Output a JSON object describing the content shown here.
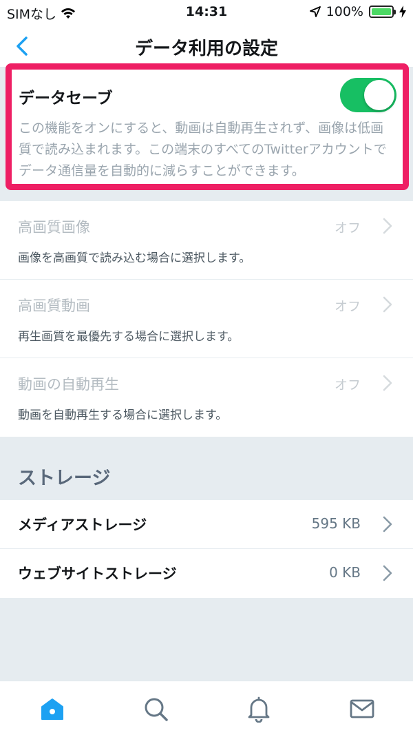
{
  "status_bar": {
    "carrier": "SIMなし",
    "time": "14:31",
    "battery": "100%",
    "wifi_icon": "wifi-icon",
    "location_icon": "location-arrow-icon",
    "charging_icon": "charging-bolt-icon"
  },
  "nav": {
    "title": "データ利用の設定",
    "back_icon": "chevron-left-icon"
  },
  "data_saver": {
    "title": "データセーブ",
    "description": "この機能をオンにすると、動画は自動再生されず、画像は低画質で読み込まれます。この端末のすべてのTwitterアカウントでデータ通信量を自動的に減らすことができます。",
    "enabled": true,
    "highlight_color": "#ee1f64",
    "toggle_color": "#17bf63"
  },
  "settings": [
    {
      "title": "高画質画像",
      "description": "画像を高画質で読み込む場合に選択します。",
      "value": "オフ"
    },
    {
      "title": "高画質動画",
      "description": "再生画質を最優先する場合に選択します。",
      "value": "オフ"
    },
    {
      "title": "動画の自動再生",
      "description": "動画を自動再生する場合に選択します。",
      "value": "オフ"
    }
  ],
  "storage": {
    "section_title": "ストレージ",
    "items": [
      {
        "label": "メディアストレージ",
        "value": "595 KB"
      },
      {
        "label": "ウェブサイトストレージ",
        "value": "0 KB"
      }
    ]
  },
  "tab_bar": {
    "tabs": [
      "home-icon",
      "search-icon",
      "notifications-bell-icon",
      "messages-envelope-icon"
    ],
    "active_color": "#1da1f2",
    "inactive_color": "#657786"
  }
}
